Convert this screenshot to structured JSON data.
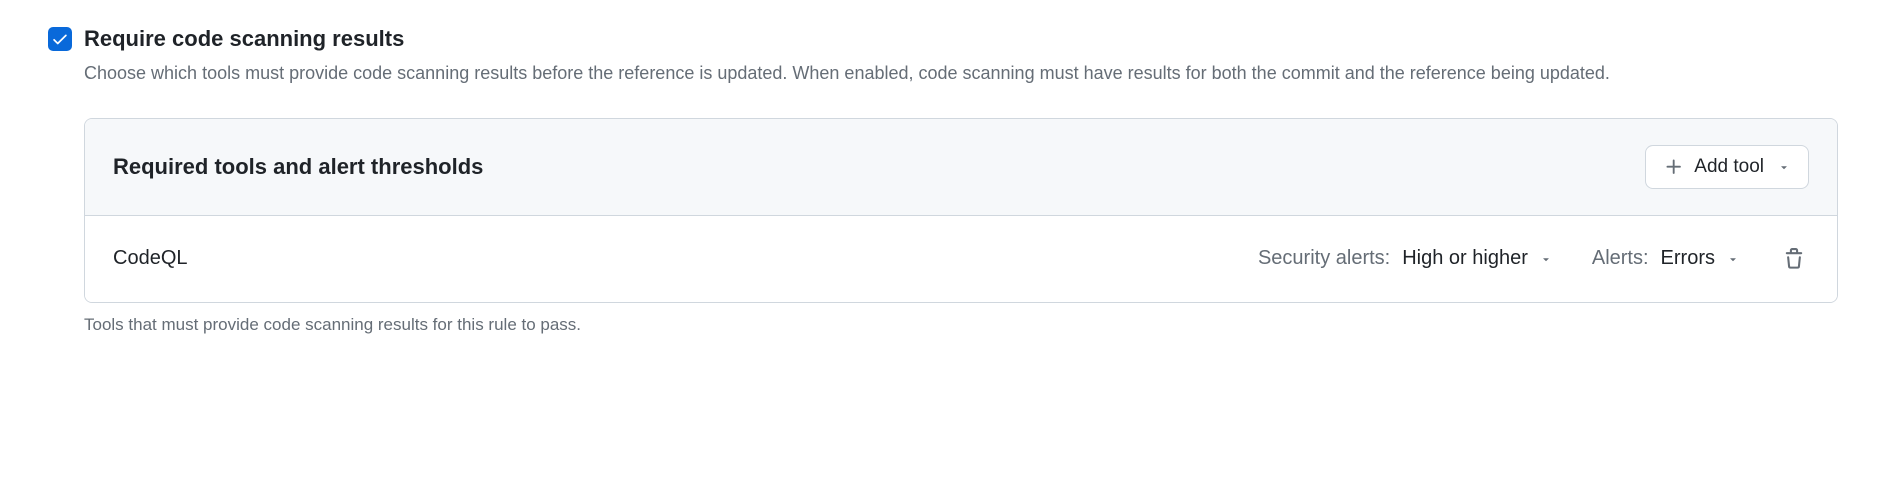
{
  "section": {
    "title": "Require code scanning results",
    "description": "Choose which tools must provide code scanning results before the reference is updated. When enabled, code scanning must have results for both the commit and the reference being updated.",
    "checked": true
  },
  "panel": {
    "title": "Required tools and alert thresholds",
    "addButton": "Add tool"
  },
  "tools": [
    {
      "name": "CodeQL",
      "securityAlertsLabel": "Security alerts:",
      "securityAlertsValue": "High or higher",
      "alertsLabel": "Alerts:",
      "alertsValue": "Errors"
    }
  ],
  "footerNote": "Tools that must provide code scanning results for this rule to pass."
}
